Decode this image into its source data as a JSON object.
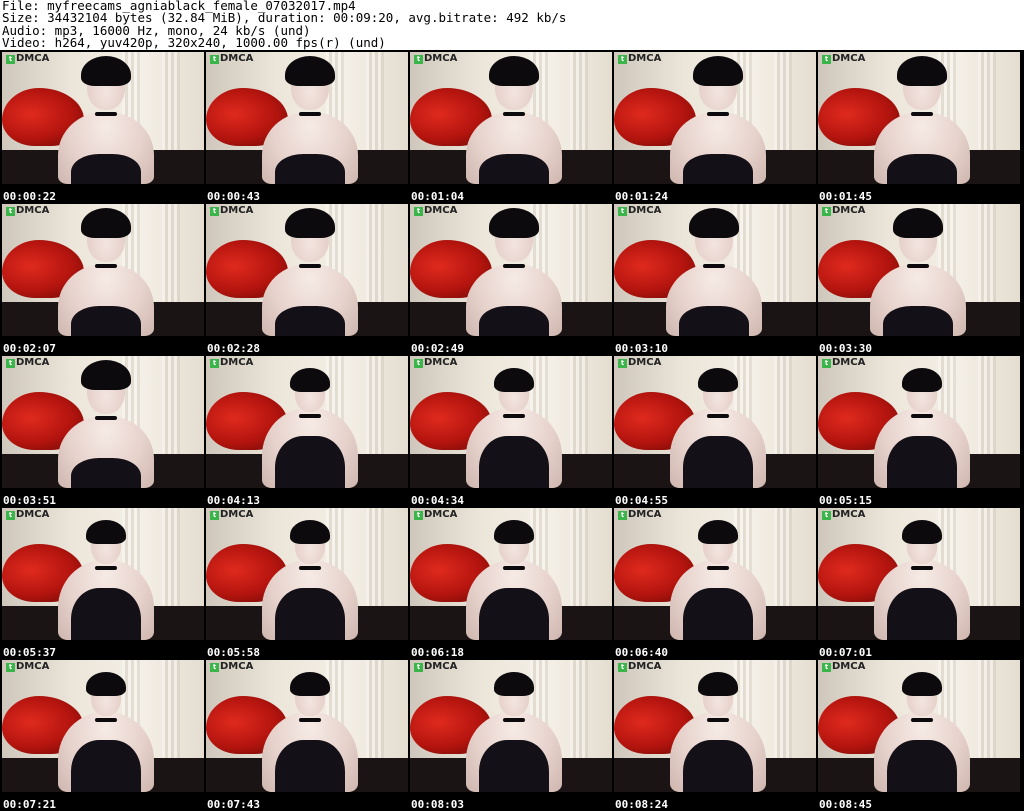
{
  "header": {
    "file_line": "File: myfreecams_agniablack_female_07032017.mp4",
    "size_line": "Size: 34432104 bytes (32.84 MiB), duration: 00:09:20, avg.bitrate: 492 kb/s",
    "audio_line": "Audio: mp3, 16000 Hz, mono, 24 kb/s (und)",
    "video_line": "Video: h264, yuv420p, 320x240, 1000.00 fps(r) (und)"
  },
  "logo": {
    "badge": "t",
    "text": "DMCA"
  },
  "thumbnails": [
    {
      "time": "00:00:22"
    },
    {
      "time": "00:00:43"
    },
    {
      "time": "00:01:04"
    },
    {
      "time": "00:01:24"
    },
    {
      "time": "00:01:45"
    },
    {
      "time": "00:02:07"
    },
    {
      "time": "00:02:28"
    },
    {
      "time": "00:02:49"
    },
    {
      "time": "00:03:10"
    },
    {
      "time": "00:03:30"
    },
    {
      "time": "00:03:51"
    },
    {
      "time": "00:04:13"
    },
    {
      "time": "00:04:34"
    },
    {
      "time": "00:04:55"
    },
    {
      "time": "00:05:15"
    },
    {
      "time": "00:05:37"
    },
    {
      "time": "00:05:58"
    },
    {
      "time": "00:06:18"
    },
    {
      "time": "00:06:40"
    },
    {
      "time": "00:07:01"
    },
    {
      "time": "00:07:21"
    },
    {
      "time": "00:07:43"
    },
    {
      "time": "00:08:03"
    },
    {
      "time": "00:08:24"
    },
    {
      "time": "00:08:45"
    }
  ],
  "colors": {
    "background": "#000000",
    "header_background": "#ffffff",
    "sofa_red": "#c8180f",
    "logo_green": "#3bb54a"
  }
}
